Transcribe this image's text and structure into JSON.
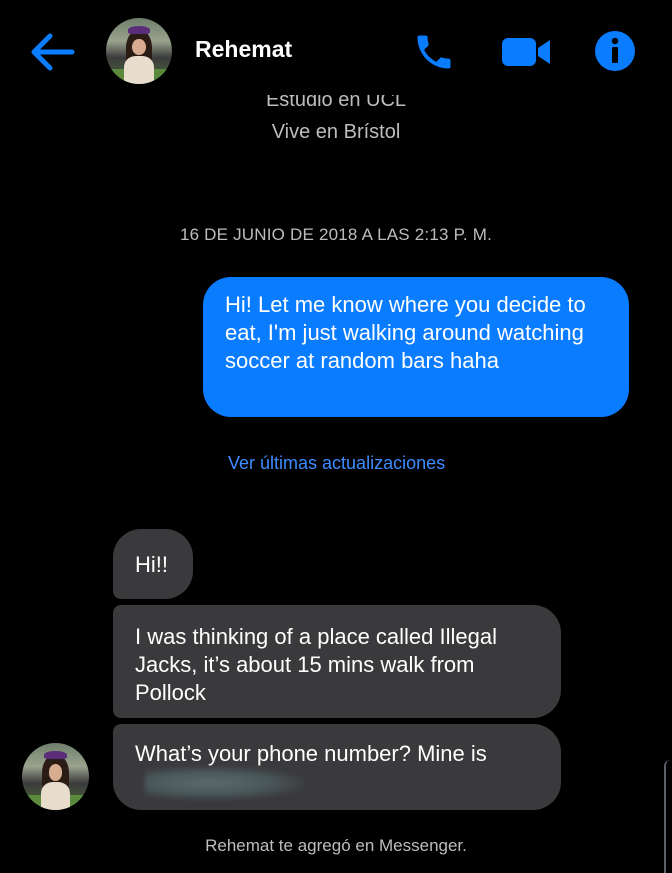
{
  "header": {
    "contact_name": "Rehemat",
    "icons": [
      "back-arrow-icon",
      "phone-icon",
      "video-camera-icon",
      "info-icon"
    ],
    "accent_color": "#0a7cff"
  },
  "profile": {
    "studies_cut": "Estudio en UCL",
    "lives": "Vive en Brístol"
  },
  "conversation": {
    "timestamp": "16 DE JUNIO DE 2018 A LAS 2:13 P. M.",
    "outgoing": [
      "Hi! Let me know where you decide to eat, I'm just walking around watching soccer at random bars haha"
    ],
    "see_updates": "Ver últimas actualizaciones",
    "incoming": [
      "Hi!!",
      "I was thinking of a place called Illegal Jacks, it’s about 15 mins walk from Pollock",
      "What’s your phone number? Mine is"
    ],
    "footer_note": "Rehemat te agregó en Messenger."
  }
}
